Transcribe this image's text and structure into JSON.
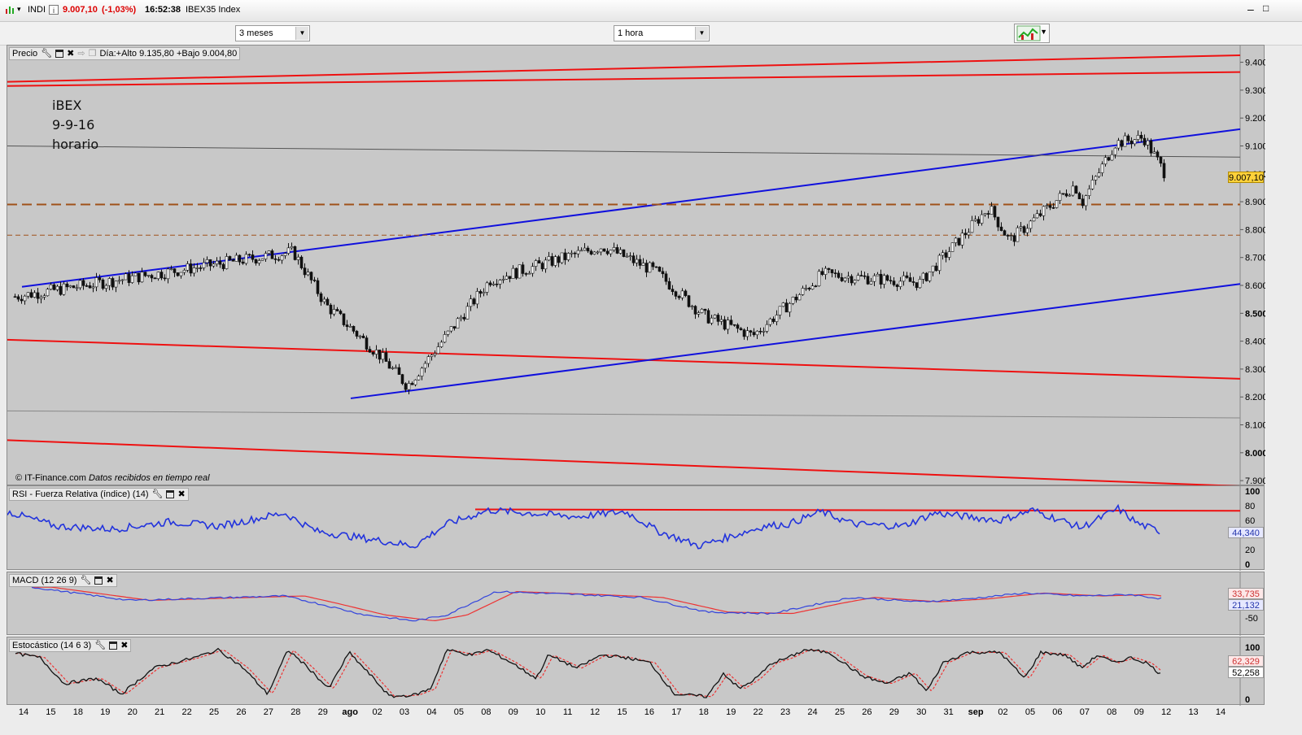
{
  "titlebar": {
    "symbol": "INDI",
    "price": "9.007,10",
    "change": "(-1,03%)",
    "time": "16:52:38",
    "instrument": "IBEX35 Index"
  },
  "toolbar": {
    "period": "3 meses",
    "interval": "1 hora"
  },
  "price_panel": {
    "label": "Precio",
    "day_info": "Día:+Alto 9.135,80 +Bajo 9.004,80",
    "annotation": [
      "iBEX",
      "9-9-16",
      "horario"
    ],
    "copyright": "© IT-Finance.com",
    "copyright_note": "Datos recibidos en tiempo real",
    "y_ticks": [
      "9.400",
      "9.300",
      "9.200",
      "9.100",
      "9.000",
      "8.900",
      "8.800",
      "8.700",
      "8.600",
      "8.500",
      "8.400",
      "8.300",
      "8.200",
      "8.100",
      "8.000",
      "7.900"
    ],
    "last_value": "9.007,10"
  },
  "rsi_panel": {
    "label": "RSI - Fuerza Relativa (índice) (14)",
    "y_ticks": [
      "100",
      "80",
      "60",
      "40",
      "20",
      "0"
    ],
    "value": "44,340"
  },
  "macd_panel": {
    "label": "MACD (12 26 9)",
    "y_ticks": [
      "-50"
    ],
    "value_signal": "33,735",
    "value_macd": "21,132"
  },
  "stoch_panel": {
    "label": "Estocástico (14 6 3)",
    "y_ticks": [
      "100",
      "0"
    ],
    "value_d": "62,329",
    "value_k": "52,258"
  },
  "x_axis": {
    "labels": [
      "14",
      "15",
      "18",
      "19",
      "20",
      "21",
      "22",
      "25",
      "26",
      "27",
      "28",
      "29",
      "ago",
      "02",
      "03",
      "04",
      "05",
      "08",
      "09",
      "10",
      "11",
      "12",
      "15",
      "16",
      "17",
      "18",
      "19",
      "22",
      "23",
      "24",
      "25",
      "26",
      "29",
      "30",
      "31",
      "sep",
      "02",
      "05",
      "06",
      "07",
      "08",
      "09",
      "12",
      "13",
      "14"
    ]
  },
  "colors": {
    "channel_red": "#ee1111",
    "trend_blue": "#1010dd",
    "support_orange": "#a0521a",
    "rsi_line": "#2233dd",
    "macd_line": "#3344dd",
    "signal_line": "#ee3333",
    "last_value_bg": "#ffd23a"
  },
  "chart_data": {
    "type": "candlestick",
    "title": "",
    "xlabel": "",
    "ylabel": "",
    "ylim": [
      7880,
      9460
    ],
    "key_points": [
      {
        "x": "14 jul",
        "y": 8560
      },
      {
        "x": "27 jul",
        "y": 8720
      },
      {
        "x": "29 jul",
        "y": 8530
      },
      {
        "x": "ago 02",
        "y": 8350
      },
      {
        "x": "03 ago",
        "y": 8240
      },
      {
        "x": "08 ago",
        "y": 8620
      },
      {
        "x": "12 ago",
        "y": 8740
      },
      {
        "x": "16 ago",
        "y": 8650
      },
      {
        "x": "18 ago",
        "y": 8490
      },
      {
        "x": "22 ago",
        "y": 8420
      },
      {
        "x": "25 ago",
        "y": 8640
      },
      {
        "x": "30 ago",
        "y": 8610
      },
      {
        "x": "sep 02",
        "y": 8880
      },
      {
        "x": "02 sep",
        "y": 8760
      },
      {
        "x": "06 sep",
        "y": 8960
      },
      {
        "x": "07 sep",
        "y": 8900
      },
      {
        "x": "08 sep",
        "y": 9110
      },
      {
        "x": "09 sep",
        "y": 9130
      },
      {
        "x": "09 sep",
        "y": 9007.1
      }
    ]
  }
}
